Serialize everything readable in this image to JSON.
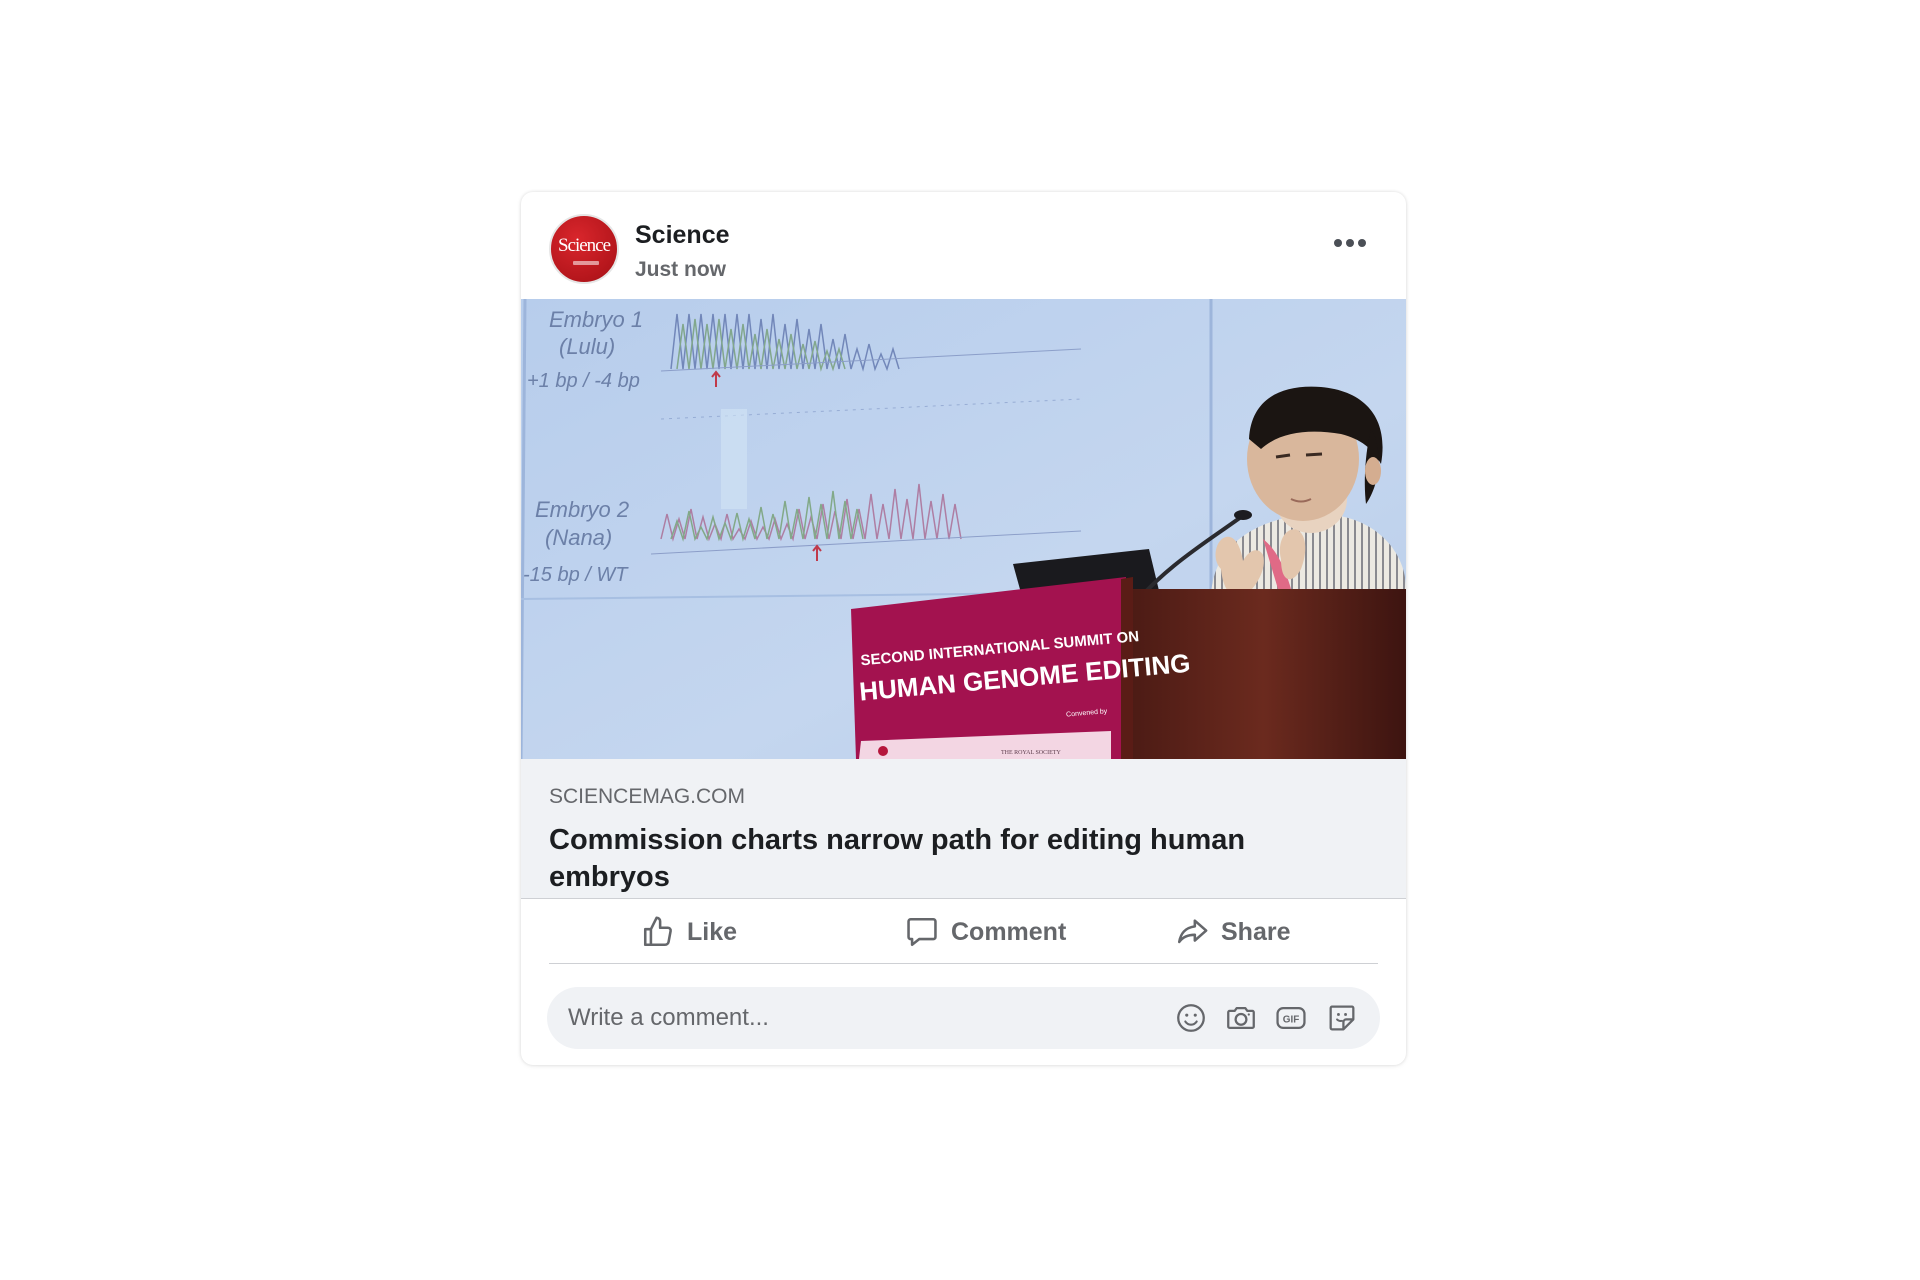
{
  "post": {
    "author": {
      "name": "Science",
      "avatar_text": "Science",
      "avatar_color": "#c4161c"
    },
    "timestamp": "Just now",
    "more_icon": "more-horizontal-icon",
    "image": {
      "slide_labels": [
        "Embryo 1",
        "(Lulu)",
        "+1 bp / -4 bp",
        "Embryo 2",
        "(Nana)",
        "-15 bp / WT"
      ],
      "podium_line1": "SECOND INTERNATIONAL SUMMIT ON",
      "podium_line2": "HUMAN GENOME EDITING",
      "podium_small": "Convened by",
      "podium_logo_right": "THE ROYAL SOCIETY"
    },
    "link": {
      "domain": "SCIENCEMAG.COM",
      "title": "Commission charts narrow path for editing human embryos"
    },
    "actions": {
      "like": "Like",
      "comment": "Comment",
      "share": "Share"
    },
    "comment_box": {
      "placeholder": "Write a comment...",
      "icons": [
        "emoji-icon",
        "camera-icon",
        "gif-icon",
        "sticker-icon"
      ]
    },
    "colors": {
      "text_primary": "#1c1e21",
      "text_secondary": "#65676b",
      "surface": "#f0f2f5",
      "podium": "#a3124f"
    }
  }
}
